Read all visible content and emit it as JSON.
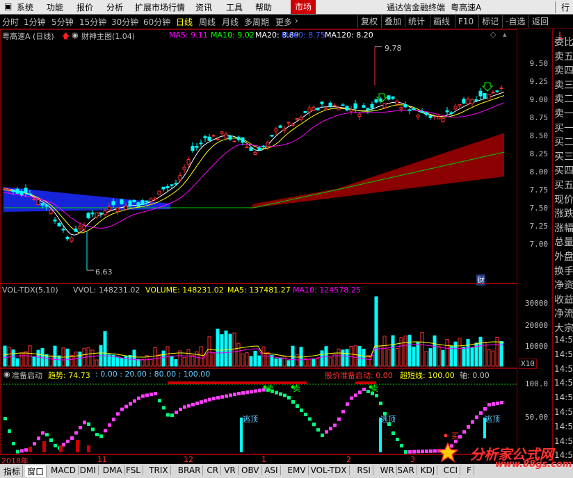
{
  "menu": {
    "items": [
      "系统",
      "功能",
      "报价",
      "分析",
      "扩展市场行情",
      "资讯",
      "工具",
      "帮助"
    ],
    "active": "市场",
    "app_title": "通达信金融终端",
    "stock": "粤高速A",
    "right_cut": "行"
  },
  "periods": {
    "items": [
      "分时",
      "1分钟",
      "5分钟",
      "15分钟",
      "30分钟",
      "60分钟",
      "日线",
      "周线",
      "月线",
      "多周期",
      "更多"
    ],
    "selected": "日线"
  },
  "toolbar": {
    "buttons": [
      "复权",
      "叠加",
      "统计",
      "画线",
      "F10",
      "-自选",
      "返回"
    ]
  },
  "main": {
    "stock_label": "粤高速A (日线)",
    "indicator": "财神主图(1.04)",
    "ma": [
      {
        "label": "MA5: 9.11",
        "color": "#ff00ff"
      },
      {
        "label": "MA10: 9.02",
        "color": "#00ff00"
      },
      {
        "label": "MA20: 8.89",
        "color": "#ffffff"
      },
      {
        "label": "MA60: 8.75",
        "color": "#3a5cff"
      },
      {
        "label": "MA120: 8.20",
        "color": "#ffffff"
      }
    ],
    "high_label": "9.78",
    "low_label": "6.63",
    "fin_tag": "财",
    "y_ticks": [
      "9.50",
      "9.25",
      "9.00",
      "8.75",
      "8.50",
      "8.25",
      "8.00",
      "7.75",
      "7.50",
      "7.25",
      "7.00"
    ]
  },
  "volume": {
    "title": "VOL-TDX(5,10)",
    "vvol": "VVOL: 148231.02",
    "volume": "VOLUME: 148231.02",
    "ma5": "MA5: 137481.27",
    "ma10": "MA10: 124578.25",
    "y_ticks": [
      "30000",
      "20000",
      "10000"
    ],
    "unit": "X10"
  },
  "osc": {
    "title": "准备启动",
    "trend": "趋势: 74.73",
    "levels": ": 0.00  : 20.00  : 80.00  : 100.00",
    "label2": "股价准备启动: 0.00",
    "label3": "超短线: 100.00",
    "label4": "轴: 0.00",
    "y_ticks": [
      "100.0",
      "50.00"
    ],
    "escape_label": "逃顶",
    "buy_label": "买",
    "sell_label": "卖",
    "x_labels": [
      "2018年",
      "11",
      "12",
      "1",
      "2",
      "3"
    ]
  },
  "right_panel": {
    "items": [
      "委比",
      "卖五",
      "卖四",
      "卖三",
      "卖二",
      "卖一",
      "买一",
      "买二",
      "买三",
      "买四",
      "买五",
      "现价",
      "涨跌",
      "涨幅",
      "总量",
      "外盘",
      "换手",
      "净资",
      "收益",
      "净流",
      "大宗"
    ],
    "top_label": "L",
    "times": [
      "14:5",
      "14:5",
      "14:5",
      "14:5",
      "14:5",
      "14:5",
      "14:5",
      "14:5",
      "14:5"
    ]
  },
  "bottom_tabs": {
    "items": [
      "指标",
      "窗口",
      "MACD",
      "DMI",
      "DMA",
      "FSL",
      "TRIX",
      "BRAR",
      "CR",
      "VR",
      "OBV",
      "ASI",
      "EMV",
      "VOL-TDX",
      "RSI",
      "WR",
      "SAR",
      "KDJ",
      "CCI",
      "F"
    ],
    "selected": "窗口"
  },
  "watermark": {
    "text": "分析家公式网",
    "url": "www.88gs.com"
  }
}
